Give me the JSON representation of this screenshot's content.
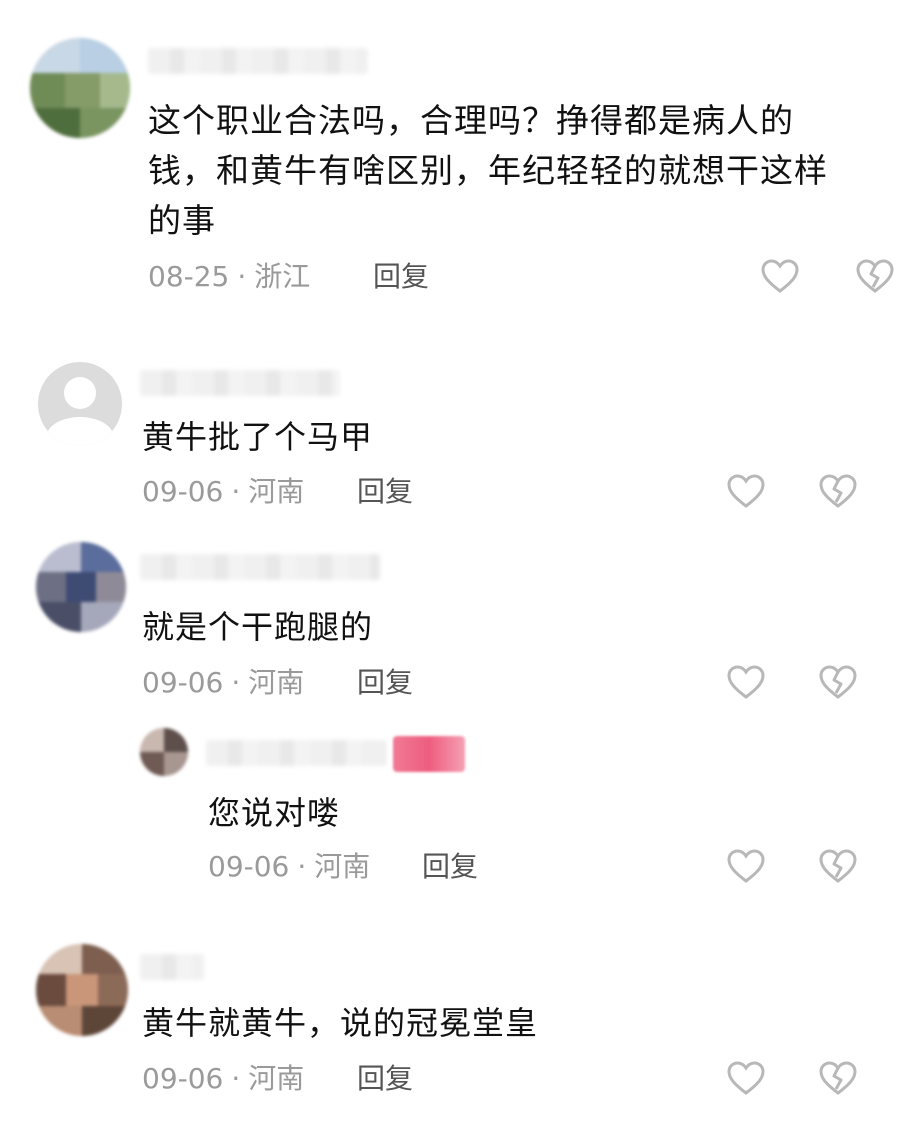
{
  "comments": [
    {
      "text_lines": [
        "这个职业合法吗，合理吗？挣得都是病人的",
        "钱，和黄牛有啥区别，年纪轻轻的就想干这样",
        "的事"
      ],
      "date": "08-25",
      "separator": "·",
      "location": "浙江",
      "reply_label": "回复",
      "avatar": "blurred-avatar",
      "like_icon": "heart-outline-icon",
      "dislike_icon": "broken-heart-icon"
    },
    {
      "text_lines": [
        "黄牛批了个马甲"
      ],
      "date": "09-06",
      "separator": "·",
      "location": "河南",
      "reply_label": "回复",
      "avatar": "default-avatar",
      "like_icon": "heart-outline-icon",
      "dislike_icon": "broken-heart-icon"
    },
    {
      "text_lines": [
        "就是个干跑腿的"
      ],
      "date": "09-06",
      "separator": "·",
      "location": "河南",
      "reply_label": "回复",
      "avatar": "blurred-avatar",
      "like_icon": "heart-outline-icon",
      "dislike_icon": "broken-heart-icon"
    },
    {
      "text_lines": [
        "您说对喽"
      ],
      "date": "09-06",
      "separator": "·",
      "location": "河南",
      "reply_label": "回复",
      "avatar": "blurred-avatar",
      "like_icon": "heart-outline-icon",
      "dislike_icon": "broken-heart-icon"
    },
    {
      "text_lines": [
        "黄牛就黄牛，说的冠冕堂皇"
      ],
      "date": "09-06",
      "separator": "·",
      "location": "河南",
      "reply_label": "回复",
      "avatar": "blurred-avatar",
      "like_icon": "heart-outline-icon",
      "dislike_icon": "broken-heart-icon"
    }
  ],
  "colors": {
    "text": "#111111",
    "meta": "#9a9a9a",
    "icon": "#b8b8b8",
    "author_tag": "#ee5d7e"
  }
}
